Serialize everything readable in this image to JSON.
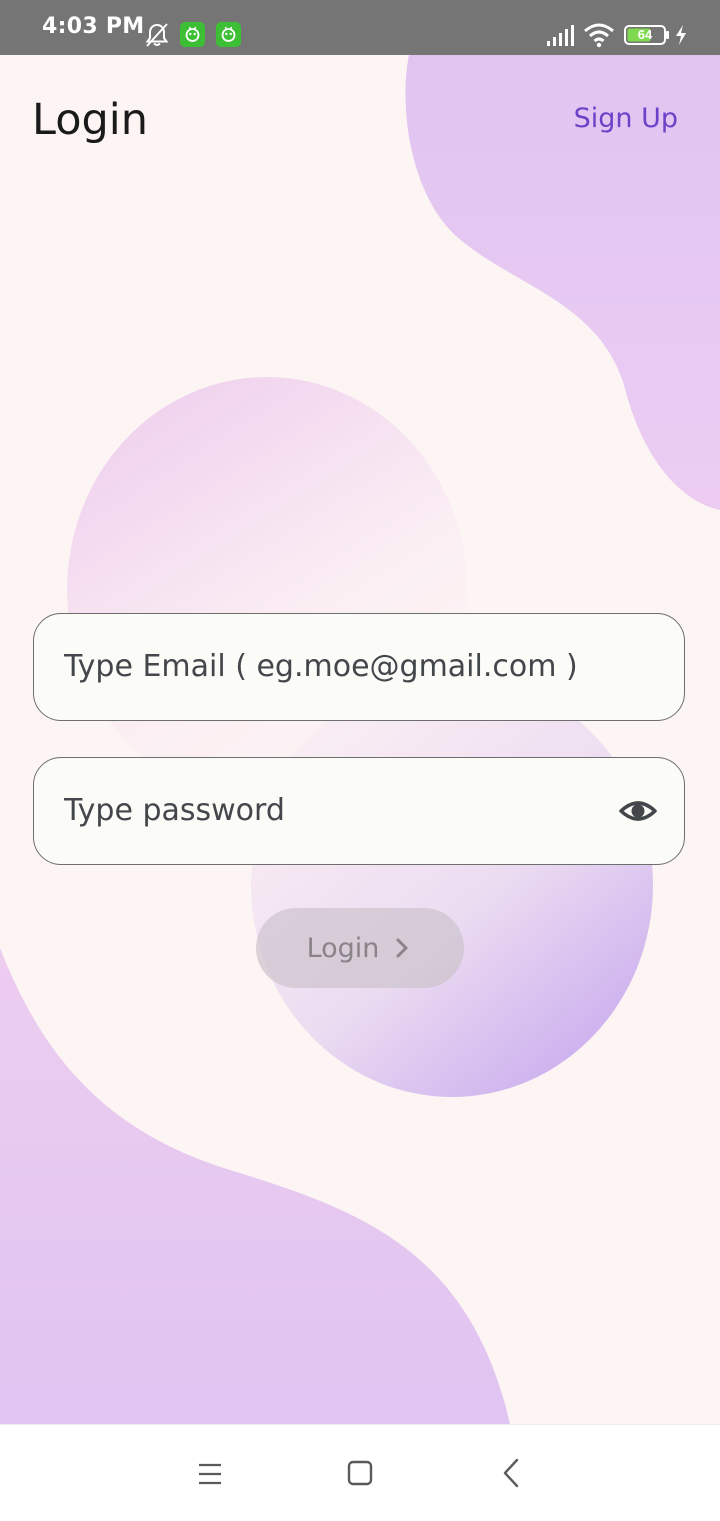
{
  "status_bar": {
    "time": "4:03 PM",
    "battery_level": "64",
    "icons": [
      "notifications-off-icon",
      "app-notification-icon",
      "app-notification-icon",
      "signal-icon",
      "wifi-icon",
      "battery-icon",
      "charging-icon"
    ]
  },
  "header": {
    "title": "Login",
    "signup_label": "Sign Up"
  },
  "form": {
    "email_placeholder": "Type Email ( eg.moe@gmail.com )",
    "email_value": "",
    "password_placeholder": "Type password",
    "password_value": "",
    "login_label": "Login"
  },
  "nav_bar": {
    "icons": [
      "menu-icon",
      "home-icon",
      "back-icon"
    ]
  },
  "colors": {
    "background": "#fdf4f4",
    "accent": "#6b42c8",
    "blob": "#e2c8f2",
    "field_background": "#fbfbf7",
    "field_border": "#6e6e6e",
    "button_disabled": "#cdc3cd"
  }
}
